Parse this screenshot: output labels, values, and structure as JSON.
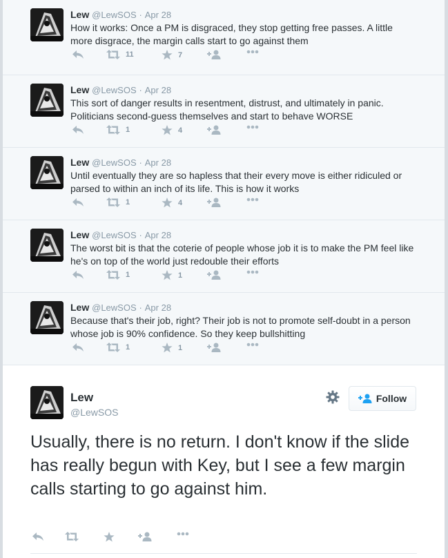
{
  "thread": [
    {
      "name": "Lew",
      "handle": "@LewSOS",
      "sep": "·",
      "date": "Apr 28",
      "text": "How it works: Once a PM is disgraced, they stop getting free passes. A little more disgrace, the margin calls start to go against them",
      "retweets": "11",
      "favorites": "7"
    },
    {
      "name": "Lew",
      "handle": "@LewSOS",
      "sep": "·",
      "date": "Apr 28",
      "text": "This sort of danger results in resentment, distrust, and ultimately in panic. Politicians second-guess themselves and start to behave WORSE",
      "retweets": "1",
      "favorites": "4"
    },
    {
      "name": "Lew",
      "handle": "@LewSOS",
      "sep": "·",
      "date": "Apr 28",
      "text": "Until eventually they are so hapless that their every move is either ridiculed or parsed to within an inch of its life. This is how it works",
      "retweets": "1",
      "favorites": "4"
    },
    {
      "name": "Lew",
      "handle": "@LewSOS",
      "sep": "·",
      "date": "Apr 28",
      "text": "The worst bit is that the coterie of people whose job it is to make the PM feel like he's on top of the world just redouble their efforts",
      "retweets": "1",
      "favorites": "1"
    },
    {
      "name": "Lew",
      "handle": "@LewSOS",
      "sep": "·",
      "date": "Apr 28",
      "text": "Because that's their job, right? Their job is not to promote self-doubt in a person whose job is 90% confidence. So they keep bullshitting",
      "retweets": "1",
      "favorites": "1"
    }
  ],
  "main": {
    "name": "Lew",
    "handle": "@LewSOS",
    "follow_label": "Follow",
    "text": "Usually, there is no return. I don't know if the slide has really begun with Key, but I see a few margin calls starting to go against him."
  },
  "icons": {
    "reply": "reply-icon",
    "retweet": "retweet-icon",
    "favorite": "star-icon",
    "follow": "add-user-icon",
    "more": "more-icon",
    "settings": "gear-icon"
  },
  "colors": {
    "icon": "#aab8c2",
    "text": "#292f33",
    "meta": "#8899a6",
    "thread_bg": "#f5f8fa"
  }
}
